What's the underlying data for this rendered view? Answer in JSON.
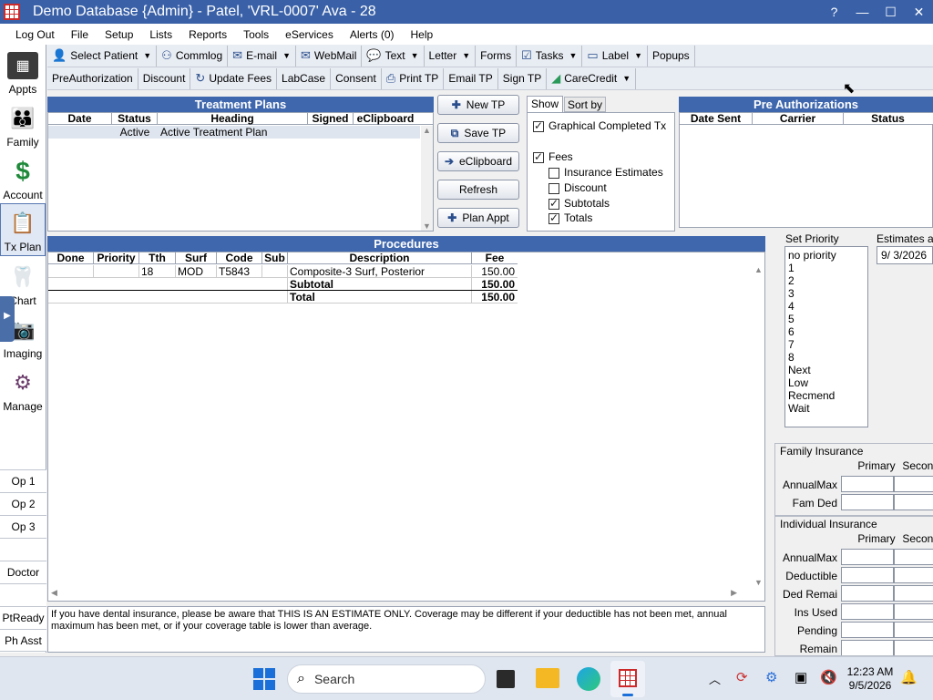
{
  "window": {
    "title": "Demo Database {Admin} - Patel, 'VRL-0007' Ava - 28",
    "help": "?",
    "minimize": "—",
    "maximize": "☐",
    "close": "✕"
  },
  "menu": [
    "Log Out",
    "File",
    "Setup",
    "Lists",
    "Reports",
    "Tools",
    "eServices",
    "Alerts (0)",
    "Help"
  ],
  "toolbar1": [
    {
      "label": "Select Patient",
      "dd": true
    },
    {
      "label": "Commlog",
      "dd": false
    },
    {
      "label": "E-mail",
      "dd": true
    },
    {
      "label": "WebMail",
      "dd": false
    },
    {
      "label": "Text",
      "dd": true
    },
    {
      "label": "Letter",
      "dd": true
    },
    {
      "label": "Forms",
      "dd": false
    },
    {
      "label": "Tasks",
      "dd": true
    },
    {
      "label": "Label",
      "dd": true
    },
    {
      "label": "Popups",
      "dd": false
    }
  ],
  "toolbar2": [
    {
      "label": "PreAuthorization",
      "dd": false
    },
    {
      "label": "Discount",
      "dd": false
    },
    {
      "label": "Update Fees",
      "dd": false
    },
    {
      "label": "LabCase",
      "dd": false
    },
    {
      "label": "Consent",
      "dd": false
    },
    {
      "label": "Print TP",
      "dd": false
    },
    {
      "label": "Email TP",
      "dd": false
    },
    {
      "label": "Sign TP",
      "dd": false
    },
    {
      "label": "CareCredit",
      "dd": true
    }
  ],
  "modules": [
    "Appts",
    "Family",
    "Account",
    "Tx Plan",
    "Chart",
    "Imaging",
    "Manage"
  ],
  "ops": [
    "Op 1",
    "Op 2",
    "Op 3",
    "",
    "Doctor",
    "",
    "PtReady",
    "Ph Asst"
  ],
  "treatment_plans": {
    "title": "Treatment Plans",
    "cols": [
      "Date",
      "Status",
      "Heading",
      "Signed",
      "eClipboard"
    ],
    "row": {
      "date": "",
      "status": "Active",
      "heading": "Active Treatment Plan",
      "signed": "",
      "eclip": ""
    }
  },
  "side_buttons": {
    "new_tp": "New TP",
    "save_tp": "Save TP",
    "eclipboard": "eClipboard",
    "refresh": "Refresh",
    "plan_appt": "Plan Appt"
  },
  "show_tabs": {
    "show": "Show",
    "sort_by": "Sort by"
  },
  "show_options": {
    "graphical": "Graphical Completed Tx",
    "fees": "Fees",
    "ins_estimates": "Insurance Estimates",
    "discount": "Discount",
    "subtotals": "Subtotals",
    "totals": "Totals"
  },
  "pre_auth": {
    "title": "Pre Authorizations",
    "cols": [
      "Date Sent",
      "Carrier",
      "Status"
    ]
  },
  "procedures": {
    "title": "Procedures",
    "cols": [
      "Done",
      "Priority",
      "Tth",
      "Surf",
      "Code",
      "Sub",
      "Description",
      "Fee"
    ],
    "row": {
      "done": "",
      "priority": "",
      "tth": "18",
      "surf": "MOD",
      "code": "T5843",
      "sub": "",
      "desc": "Composite-3 Surf, Posterior",
      "fee": "150.00"
    },
    "subtotal_label": "Subtotal",
    "subtotal": "150.00",
    "total_label": "Total",
    "total": "150.00"
  },
  "set_priority": {
    "label": "Set Priority",
    "items": [
      "no priority",
      "1",
      "2",
      "3",
      "4",
      "5",
      "6",
      "7",
      "8",
      "Next",
      "Low",
      "Recmend",
      "Wait"
    ]
  },
  "estimates": {
    "label": "Estimates as o",
    "date": "9/  3/2026"
  },
  "family_ins": {
    "label": "Family Insurance",
    "primary": "Primary",
    "secondary": "Seconda",
    "rows": [
      "AnnualMax",
      "Fam Ded"
    ]
  },
  "indiv_ins": {
    "label": "Individual Insurance",
    "primary": "Primary",
    "secondary": "Seconda",
    "rows": [
      "AnnualMax",
      "Deductible",
      "Ded Remai",
      "Ins Used",
      "Pending",
      "Remain"
    ]
  },
  "note": "If you have dental insurance, please be aware that THIS IS AN ESTIMATE ONLY.  Coverage may be different if your deductible has not been met, annual maximum has been met, or if your coverage table is lower than average.",
  "taskbar": {
    "search": "Search",
    "time": "12:23 AM",
    "date": "9/5/2026"
  }
}
